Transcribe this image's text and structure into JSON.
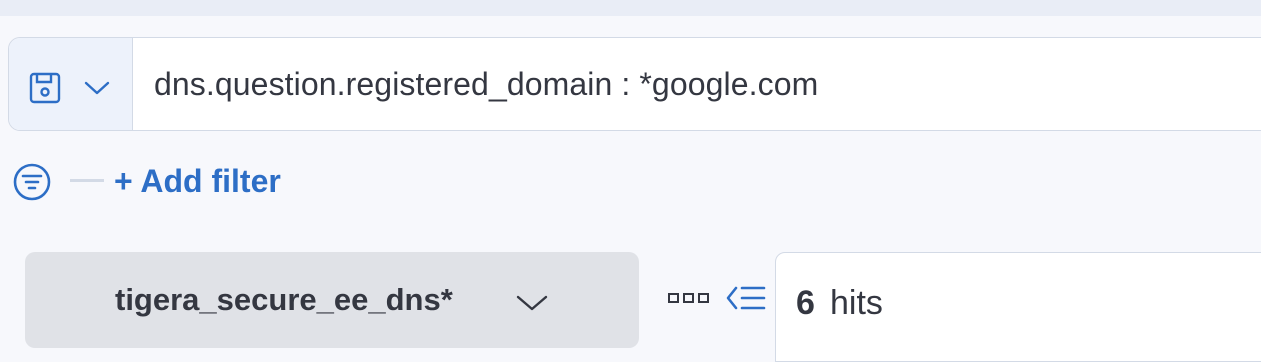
{
  "query_bar": {
    "saved_query_icon": "save-icon",
    "dropdown_icon": "chevron-down-icon",
    "query": "dns.question.registered_domain : *google.com"
  },
  "filters": {
    "filter_icon": "filter-icon",
    "add_filter_label": "+ Add filter"
  },
  "index_pattern": {
    "label": "tigera_secure_ee_dns*",
    "dropdown_icon": "chevron-down-icon"
  },
  "toolbar": {
    "field_options_icon": "dots-icon",
    "collapse_icon": "collapse-sidebar-icon"
  },
  "results": {
    "hit_count": "6",
    "hit_label": "hits"
  },
  "colors": {
    "accent": "#2d6ec6",
    "text": "#343741",
    "border": "#d3dae6"
  }
}
